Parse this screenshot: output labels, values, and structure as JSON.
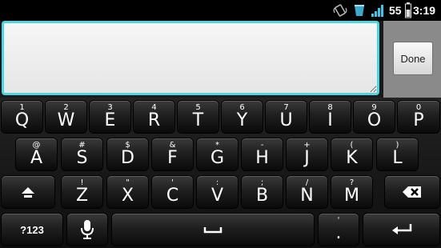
{
  "status_bar": {
    "battery_level": "55",
    "time": "3:19",
    "icons": [
      "vibrate-icon",
      "cup-icon",
      "signal-icon",
      "battery-icon"
    ]
  },
  "text_field": {
    "value": "",
    "placeholder": ""
  },
  "done_button": {
    "label": "Done"
  },
  "keyboard": {
    "row1": [
      {
        "hint": "1",
        "label": "Q"
      },
      {
        "hint": "2",
        "label": "W"
      },
      {
        "hint": "3",
        "label": "E"
      },
      {
        "hint": "4",
        "label": "R"
      },
      {
        "hint": "5",
        "label": "T"
      },
      {
        "hint": "6",
        "label": "Y"
      },
      {
        "hint": "7",
        "label": "U"
      },
      {
        "hint": "8",
        "label": "I"
      },
      {
        "hint": "9",
        "label": "O"
      },
      {
        "hint": "0",
        "label": "P"
      }
    ],
    "row2": [
      {
        "hint": "@",
        "label": "A"
      },
      {
        "hint": "#",
        "label": "S"
      },
      {
        "hint": "$",
        "label": "D"
      },
      {
        "hint": "&",
        "label": "F"
      },
      {
        "hint": "*",
        "label": "G"
      },
      {
        "hint": "-",
        "label": "H"
      },
      {
        "hint": "+",
        "label": "J"
      },
      {
        "hint": "(",
        "label": "K"
      },
      {
        "hint": ")",
        "label": "L"
      }
    ],
    "row3": [
      {
        "hint": "!",
        "label": "Z"
      },
      {
        "hint": "\"",
        "label": "X"
      },
      {
        "hint": "'",
        "label": "C"
      },
      {
        "hint": ":",
        "label": "V"
      },
      {
        "hint": ";",
        "label": "B"
      },
      {
        "hint": "/",
        "label": "N"
      },
      {
        "hint": "?",
        "label": "M"
      }
    ],
    "symbols_label": "?123",
    "period_hint": "'",
    "period_label": ".",
    "accent_color": "#4fd5df"
  }
}
